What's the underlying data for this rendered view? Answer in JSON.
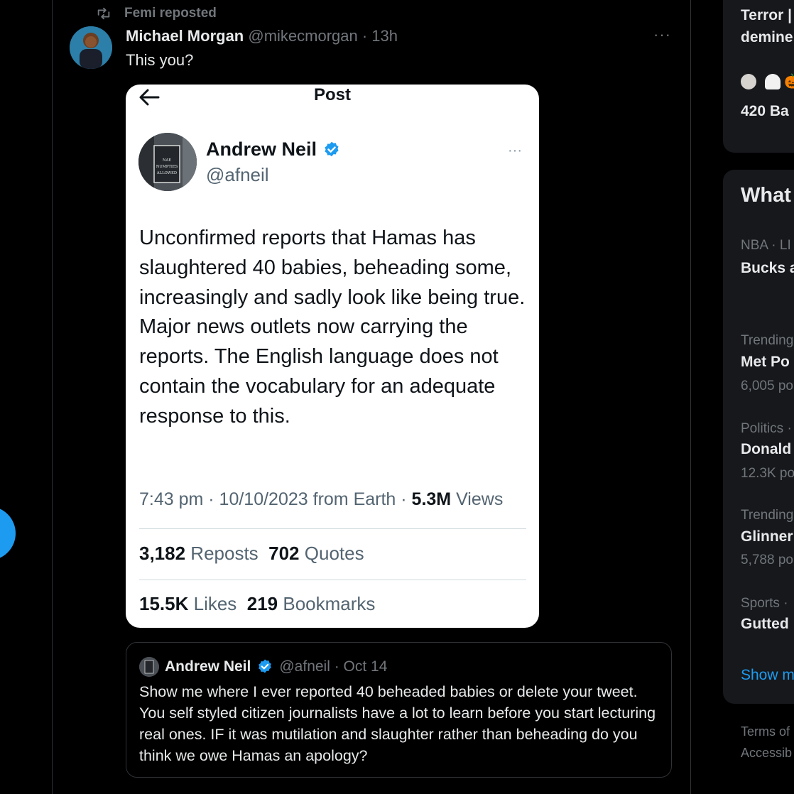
{
  "repost": {
    "label": "Femi reposted"
  },
  "tweet": {
    "author_name": "Michael Morgan",
    "author_meta": "@mikecmorgan · 13h",
    "more": "···",
    "text": "This you?"
  },
  "embedded_post": {
    "header_title": "Post",
    "author_name": "Andrew Neil",
    "author_handle": "@afneil",
    "avatar_sign_text": "NAE NUMPTIES ALLOWED",
    "more": "···",
    "body": "Unconfirmed reports that Hamas has slaughtered 40 babies, beheading some, increasingly and sadly look like being true. Major news outlets now carrying the reports. The English language does not contain the vocabulary for an adequate response to this.",
    "meta_prefix": "7:43 pm · 10/10/2023 from Earth · ",
    "views_count": "5.3M",
    "views_label": " Views",
    "reposts_count": "3,182",
    "reposts_label": " Reposts",
    "quotes_count": "702",
    "quotes_label": " Quotes",
    "likes_count": "15.5K",
    "likes_label": " Likes",
    "bookmarks_count": "219",
    "bookmarks_label": " Bookmarks"
  },
  "quote": {
    "author_name": "Andrew Neil",
    "author_meta": "@afneil · Oct 14",
    "body": "Show me where I ever reported 40 beheaded babies or delete your tweet. You self styled citizen journalists have a lot to learn before you start lecturing real ones. IF it was mutilation and slaughter rather than beheading do you think we owe Hamas an apology?"
  },
  "sidebar": {
    "top_card": {
      "line1": "Terror |",
      "line2": "demine",
      "emoji_row": "🎃",
      "title": "420 Ba"
    },
    "whats_happening": {
      "heading": "What",
      "trends": [
        {
          "category": "NBA · LI",
          "title": "Bucks a",
          "count": ""
        },
        {
          "category": "Trending",
          "title": "Met Po",
          "count": "6,005 po"
        },
        {
          "category": "Politics ·",
          "title": "Donald",
          "count": "12.3K po"
        },
        {
          "category": "Trending",
          "title": "Glinner",
          "count": "5,788 po"
        },
        {
          "category": "Sports ·",
          "title": "Gutted",
          "count": ""
        }
      ],
      "show_more": "Show m"
    },
    "footer": {
      "terms": "Terms of",
      "accessibility": "Accessib"
    }
  },
  "colors": {
    "background": "#000000",
    "accent": "#1d9bf0",
    "muted": "#71767b",
    "card_bg": "#16181c"
  }
}
